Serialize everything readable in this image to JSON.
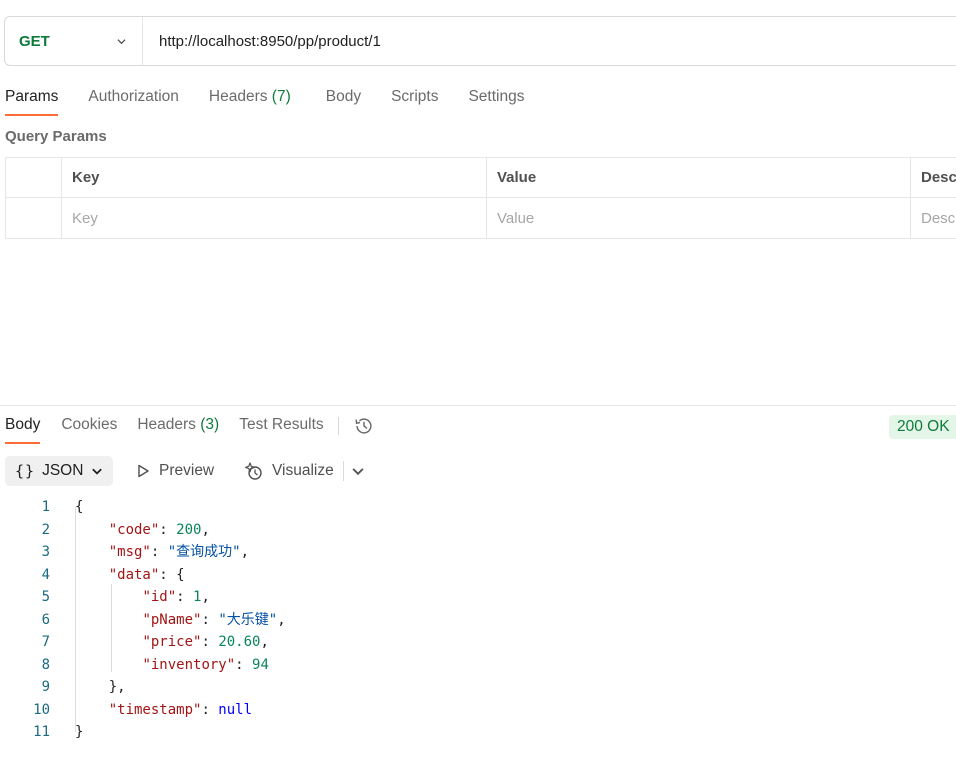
{
  "request": {
    "method": "GET",
    "url": "http://localhost:8950/pp/product/1"
  },
  "request_tabs": [
    {
      "label": "Params",
      "active": true
    },
    {
      "label": "Authorization"
    },
    {
      "label": "Headers",
      "count": "(7)"
    },
    {
      "label": "Body"
    },
    {
      "label": "Scripts"
    },
    {
      "label": "Settings"
    }
  ],
  "query_params": {
    "title": "Query Params",
    "headers": [
      "Key",
      "Value",
      "Desc"
    ],
    "placeholders": [
      "Key",
      "Value",
      "Desc"
    ]
  },
  "response_tabs": [
    {
      "label": "Body",
      "active": true
    },
    {
      "label": "Cookies"
    },
    {
      "label": "Headers",
      "count": "(3)"
    },
    {
      "label": "Test Results"
    }
  ],
  "status": "200 OK",
  "toolbar": {
    "format_brace": "{}",
    "format_label": "JSON",
    "preview_label": "Preview",
    "visualize_label": "Visualize"
  },
  "response_body": {
    "line_numbers": [
      "1",
      "2",
      "3",
      "4",
      "5",
      "6",
      "7",
      "8",
      "9",
      "10",
      "11"
    ],
    "code": 200,
    "msg": "查询成功",
    "data": {
      "id": 1,
      "pName": "大乐键",
      "price": "20.60",
      "inventory": 94
    },
    "timestamp": "null"
  },
  "colors": {
    "accent": "#ff6c37",
    "method_green": "#0f7b3b",
    "status_bg": "#e3f6e7",
    "json_key": "#a31515",
    "json_string": "#0451a5",
    "json_number": "#098658",
    "json_keyword": "#0000ff"
  },
  "icons": [
    "chevron-down-icon",
    "history-icon",
    "play-icon",
    "visualize-icon",
    "chevron-down-icon"
  ]
}
